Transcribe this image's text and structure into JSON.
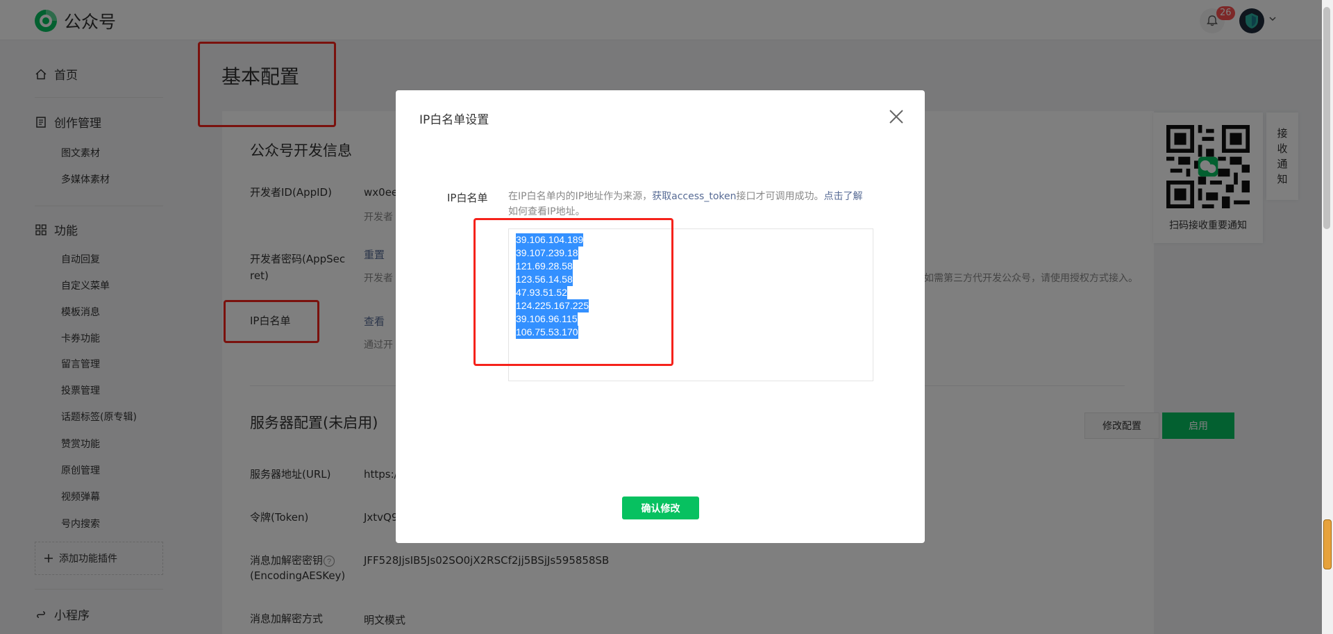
{
  "app": {
    "title": "公众号"
  },
  "header": {
    "notification_count": "26"
  },
  "sidebar": {
    "home": "首页",
    "content": {
      "label": "创作管理",
      "items": [
        "图文素材",
        "多媒体素材"
      ]
    },
    "functions": {
      "label": "功能",
      "items": [
        "自动回复",
        "自定义菜单",
        "模板消息",
        "卡券功能",
        "留言管理",
        "投票管理",
        "话题标签(原专辑)",
        "赞赏功能",
        "原创管理",
        "视频弹幕",
        "号内搜索"
      ]
    },
    "add_plugin": "添加功能插件",
    "mini_program": "小程序"
  },
  "main": {
    "page_title": "基本配置",
    "dev_info": {
      "title": "公众号开发信息",
      "appid_label": "开发者ID(AppID)",
      "appid_value": "wx0ee",
      "appid_desc": "开发者",
      "secret_label_1": "开发者密码(AppSec",
      "secret_label_2": "ret)",
      "secret_action": "重置",
      "secret_desc": "开发者",
      "secret_desc_right": "如需第三方代开发公众号，请使用授权方式接入。",
      "ip_label": "IP白名单",
      "ip_action": "查看",
      "ip_desc": "通过开"
    },
    "server": {
      "title": "服务器配置(未启用)",
      "modify_btn": "修改配置",
      "enable_btn": "启用",
      "url_label": "服务器地址(URL)",
      "url_value": "https:/",
      "token_label": "令牌(Token)",
      "token_value": "JxtvQ9",
      "aes_label_1": "消息加解密密钥",
      "aes_label_2": "(EncodingAESKey)",
      "aes_value": "JFF528JjsIB5Js02SO0jX2RSCf2jj5BSjJs595858SB",
      "mode_label": "消息加解密方式",
      "mode_value": "明文模式"
    }
  },
  "qr_panel": {
    "caption": "扫码接收重要通知",
    "tab_chars": [
      "接",
      "收",
      "通",
      "知"
    ]
  },
  "modal": {
    "title": "IP白名单设置",
    "field_label": "IP白名单",
    "hint_part1": "在IP白名单内的IP地址作为来源，",
    "hint_link1": "获取access_token",
    "hint_part2": "接口才可调用成功。",
    "hint_link2": "点击了解",
    "hint_part3": "如何查看IP地址。",
    "ips": [
      "39.106.104.189",
      "39.107.239.18",
      "121.69.28.58",
      "123.56.14.58",
      "47.93.51.52",
      "124.225.167.225",
      "39.106.96.115",
      "106.75.53.170"
    ],
    "confirm": "确认修改"
  },
  "colors": {
    "brand_green": "#07c160",
    "annotation_red": "#f5221b",
    "selection_blue": "#3390ff",
    "link": "#576b95"
  }
}
